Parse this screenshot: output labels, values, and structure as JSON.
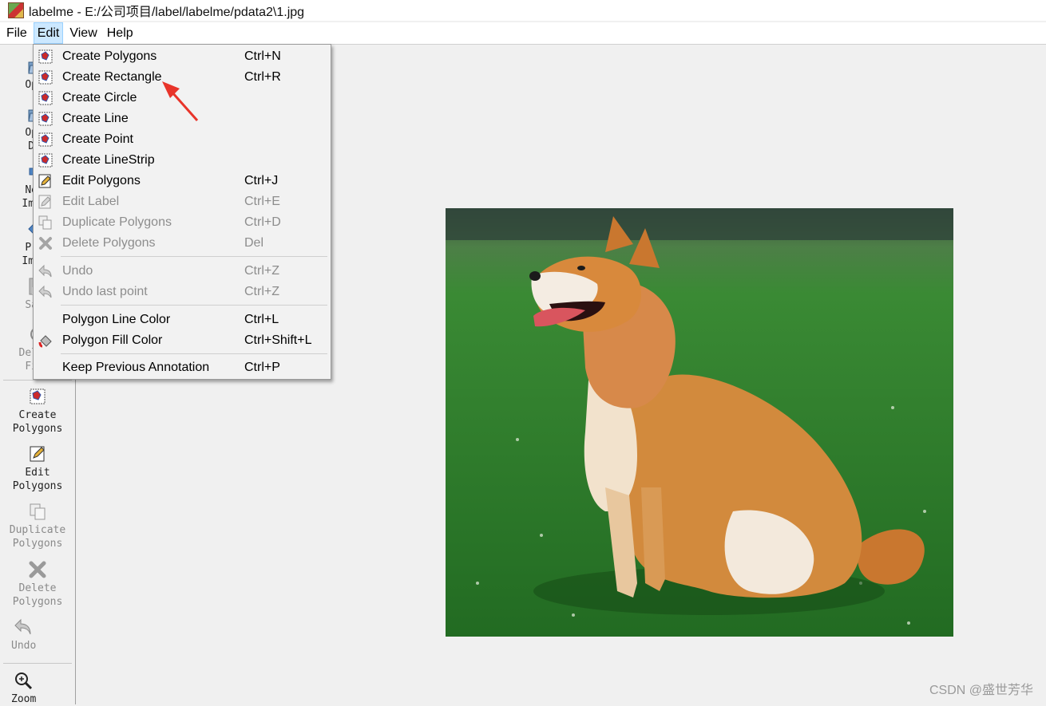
{
  "window": {
    "title": "labelme - E:/公司项目/label/labelme/pdata2\\1.jpg"
  },
  "menubar": {
    "items": [
      {
        "label": "File"
      },
      {
        "label": "Edit"
      },
      {
        "label": "View"
      },
      {
        "label": "Help"
      }
    ]
  },
  "toolbar": {
    "items": [
      {
        "label1": "Open",
        "label2": "",
        "icon": "folder-open-icon"
      },
      {
        "label1": "Open",
        "label2": "Dir",
        "icon": "folder-open-icon"
      },
      {
        "label1": "Next",
        "label2": "Image",
        "icon": "arrow-right-icon"
      },
      {
        "label1": "Prev",
        "label2": "Image",
        "icon": "arrow-left-icon"
      },
      {
        "label1": "Save",
        "label2": "",
        "icon": "save-icon"
      },
      {
        "label1": "Delete",
        "label2": "File",
        "icon": "delete-file-icon"
      },
      {
        "label1": "Create",
        "label2": "Polygons",
        "icon": "polygon-icon"
      },
      {
        "label1": "Edit",
        "label2": "Polygons",
        "icon": "edit-icon"
      },
      {
        "label1": "Duplicate",
        "label2": "Polygons",
        "icon": "copy-icon"
      },
      {
        "label1": "Delete",
        "label2": "Polygons",
        "icon": "cross-icon"
      },
      {
        "label1": "Undo",
        "label2": "",
        "icon": "undo-icon"
      },
      {
        "label1": "Zoom",
        "label2": "",
        "icon": "zoom-icon"
      }
    ]
  },
  "edit_menu": {
    "items": [
      {
        "label": "Create Polygons",
        "shortcut": "Ctrl+N"
      },
      {
        "label": "Create Rectangle",
        "shortcut": "Ctrl+R"
      },
      {
        "label": "Create Circle",
        "shortcut": ""
      },
      {
        "label": "Create Line",
        "shortcut": ""
      },
      {
        "label": "Create Point",
        "shortcut": ""
      },
      {
        "label": "Create LineStrip",
        "shortcut": ""
      },
      {
        "label": "Edit Polygons",
        "shortcut": "Ctrl+J"
      },
      {
        "label": "Edit Label",
        "shortcut": "Ctrl+E"
      },
      {
        "label": "Duplicate Polygons",
        "shortcut": "Ctrl+D"
      },
      {
        "label": "Delete Polygons",
        "shortcut": "Del"
      },
      {
        "label": "Undo",
        "shortcut": "Ctrl+Z"
      },
      {
        "label": "Undo last point",
        "shortcut": "Ctrl+Z"
      },
      {
        "label": "Polygon Line Color",
        "shortcut": "Ctrl+L"
      },
      {
        "label": "Polygon Fill Color",
        "shortcut": "Ctrl+Shift+L"
      },
      {
        "label": "Keep Previous Annotation",
        "shortcut": "Ctrl+P"
      }
    ]
  },
  "watermark": "CSDN @盛世芳华",
  "colors": {
    "menu_highlight": "#cce8ff",
    "annotation_arrow": "#e8342a",
    "disabled_text": "#8d8d8d"
  }
}
